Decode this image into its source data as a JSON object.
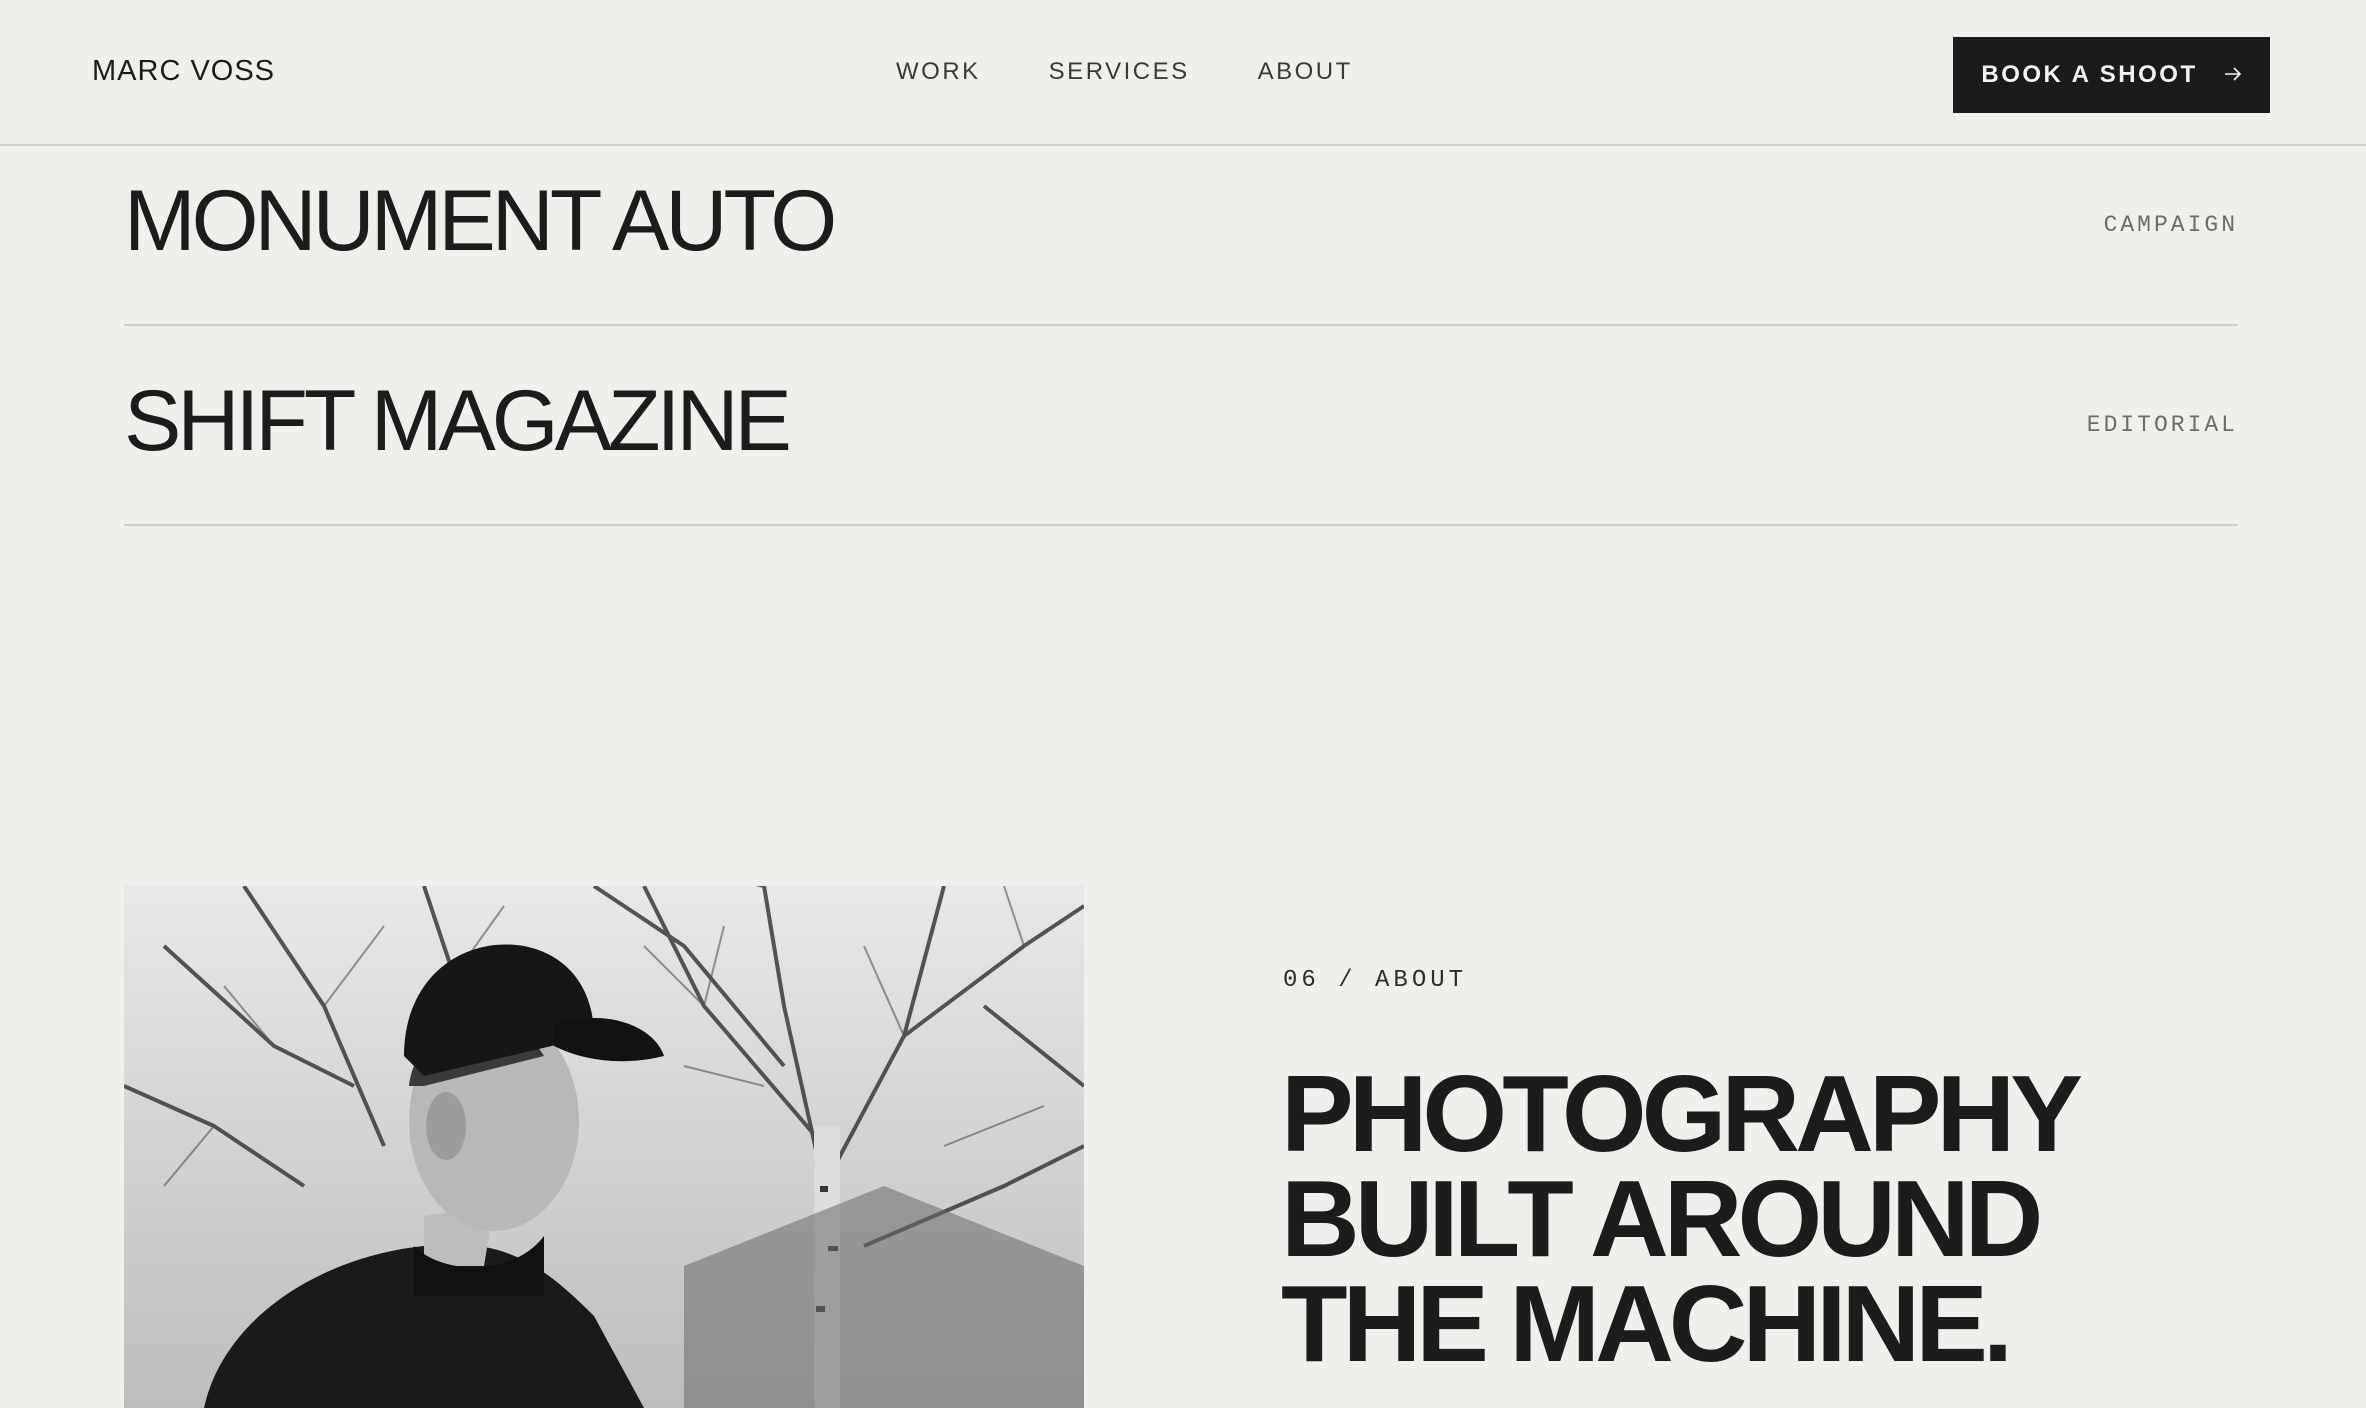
{
  "header": {
    "brand": "MARC VOSS",
    "nav": [
      "WORK",
      "SERVICES",
      "ABOUT"
    ],
    "cta_label": "BOOK A SHOOT",
    "cta_icon": "arrow-right-icon"
  },
  "projects": [
    {
      "name": "MONUMENT AUTO",
      "category": "CAMPAIGN"
    },
    {
      "name": "SHIFT MAGAZINE",
      "category": "EDITORIAL"
    }
  ],
  "about": {
    "label": "06 / ABOUT",
    "headline": [
      "PHOTOGRAPHY",
      "BUILT AROUND",
      "THE MACHINE."
    ],
    "photo": "black-and-white portrait"
  },
  "colors": {
    "background": "#f0efeb",
    "text": "#1c1c1c",
    "cta_bg": "#1b1b1b",
    "divider": "#cfcdc8"
  }
}
